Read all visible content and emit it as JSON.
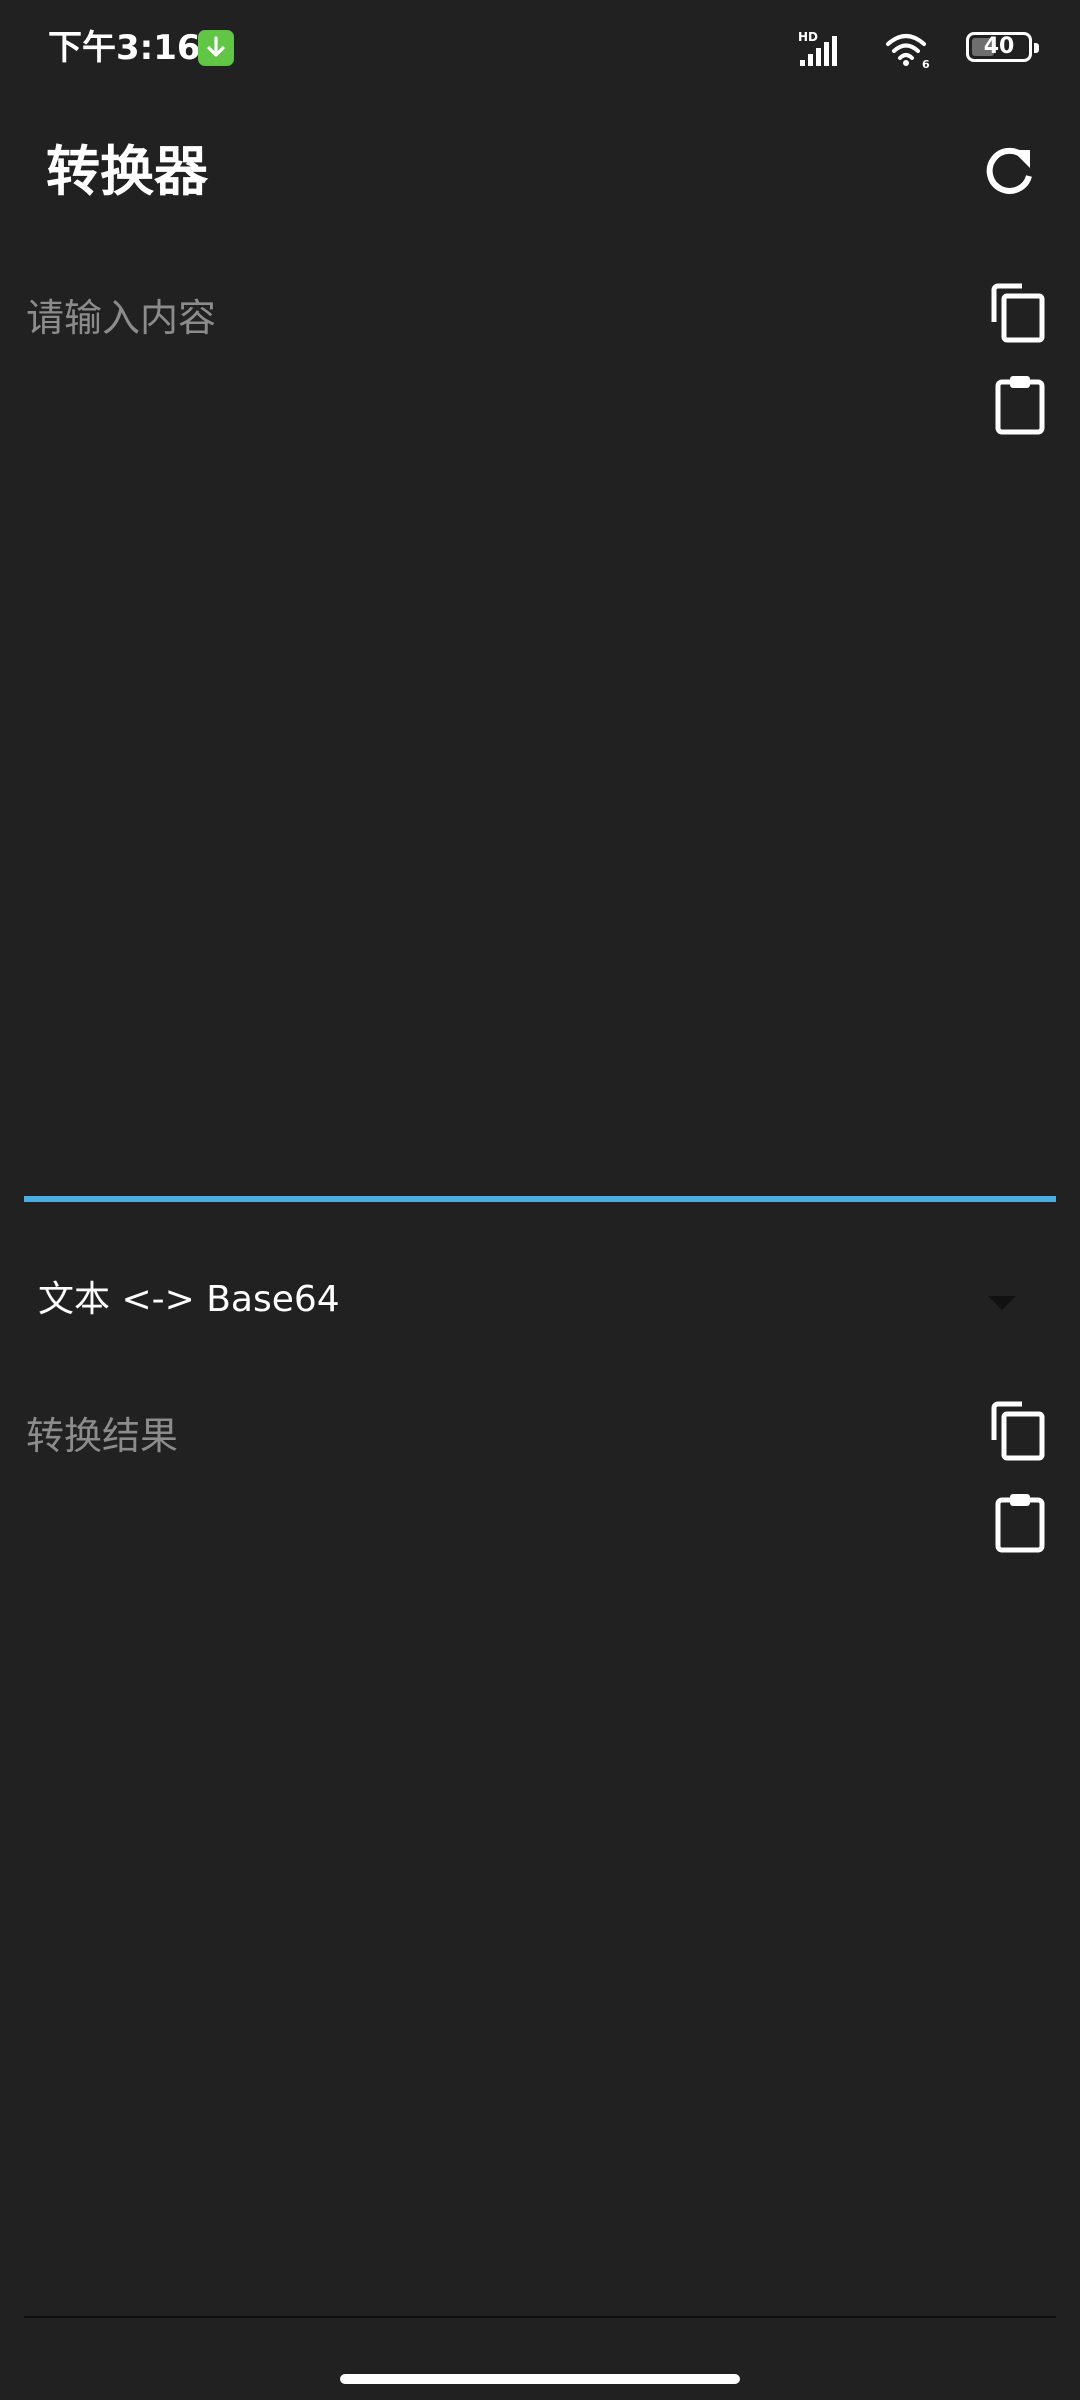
{
  "status_bar": {
    "time": "下午3:16",
    "download_icon": "download-arrow-icon",
    "signal_label": "HD",
    "wifi_label": "6",
    "battery_level": "40",
    "battery_fraction": 0.4
  },
  "app_bar": {
    "title": "转换器",
    "refresh_icon": "refresh-icon"
  },
  "input": {
    "placeholder": "请输入内容",
    "value": "",
    "copy_icon": "copy-icon",
    "paste_icon": "clipboard-icon"
  },
  "mode_select": {
    "selected": "文本 <-> Base64",
    "arrow_icon": "dropdown-triangle-icon"
  },
  "output": {
    "placeholder": "转换结果",
    "value": "",
    "copy_icon": "copy-icon",
    "paste_icon": "clipboard-icon"
  },
  "colors": {
    "background": "#212121",
    "accent": "#4aaee5",
    "placeholder": "#8c8c8c",
    "download_badge": "#61c545"
  }
}
